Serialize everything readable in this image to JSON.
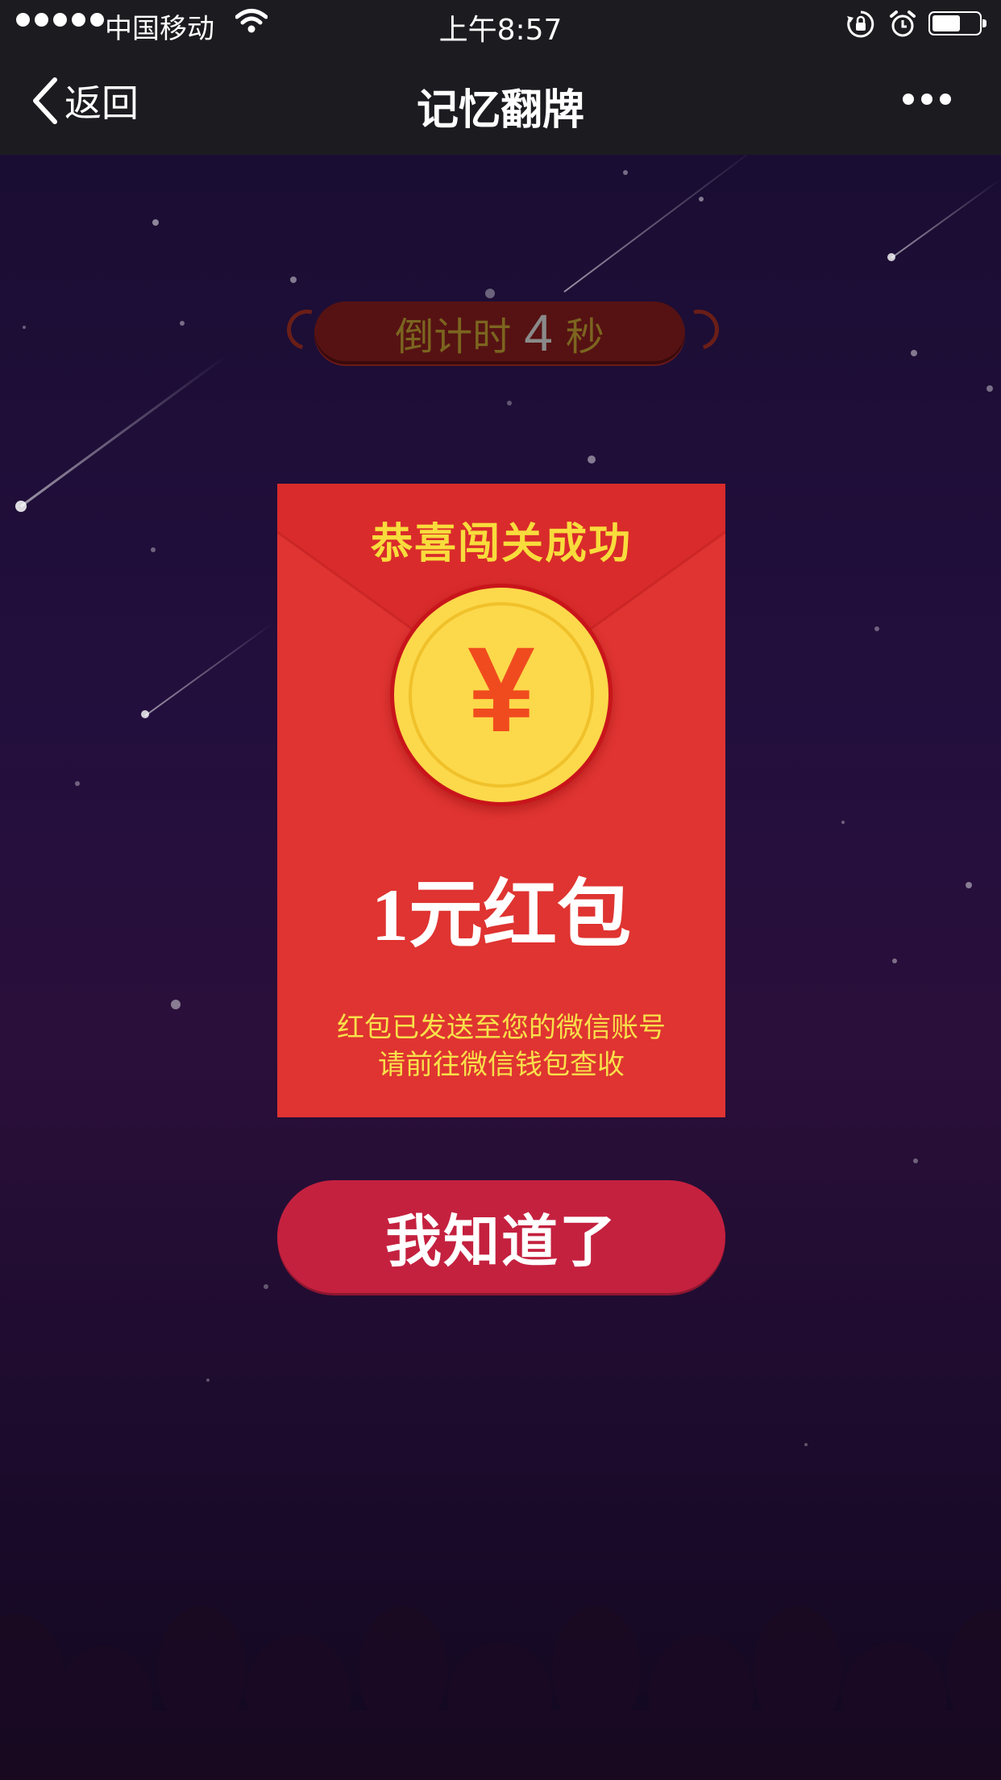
{
  "status_bar": {
    "carrier": "中国移动",
    "time": "上午8:57",
    "battery_level": 0.6
  },
  "nav": {
    "back_label": "返回",
    "title": "记忆翻牌"
  },
  "countdown": {
    "prefix": "倒计时",
    "seconds": "4",
    "suffix": "秒"
  },
  "reward": {
    "title": "恭喜闯关成功",
    "currency_symbol": "¥",
    "amount_text": "1元红包",
    "notice_line1": "红包已发送至您的微信账号",
    "notice_line2": "请前往微信钱包查收"
  },
  "actions": {
    "confirm_label": "我知道了"
  },
  "colors": {
    "envelope_red": "#df3431",
    "coin_gold": "#fcd84b",
    "button_red": "#c4213f",
    "title_yellow": "#f8dc3c",
    "countdown_bg": "#561213"
  }
}
